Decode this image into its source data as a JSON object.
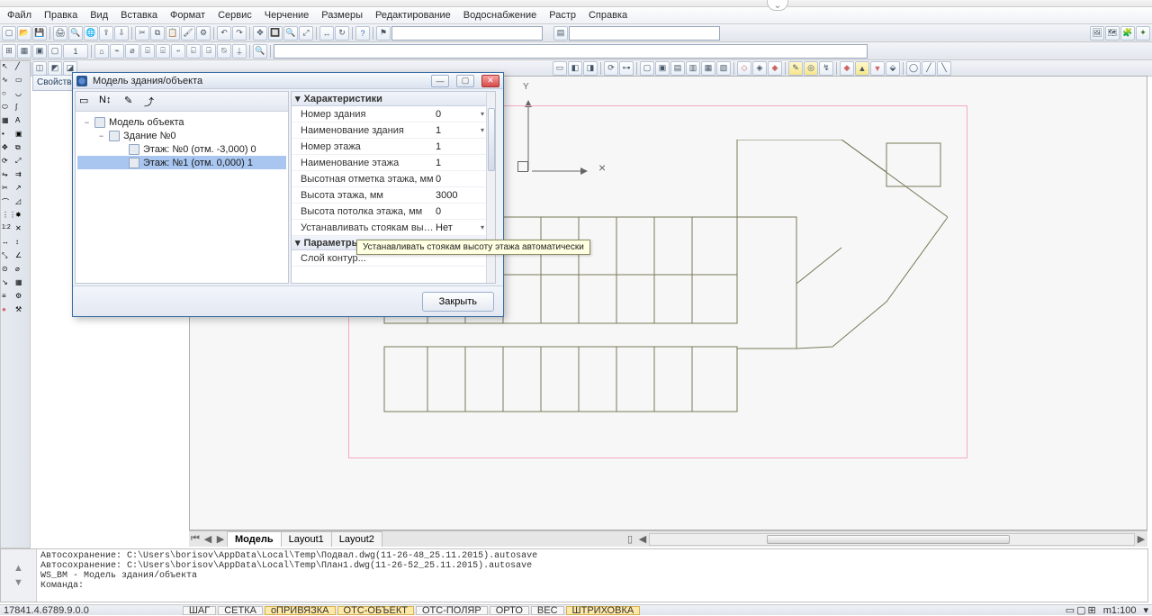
{
  "menubar": [
    "Файл",
    "Правка",
    "Вид",
    "Вставка",
    "Формат",
    "Сервис",
    "Черчение",
    "Размеры",
    "Редактирование",
    "Водоснабжение",
    "Растр",
    "Справка"
  ],
  "dialog": {
    "title": "Модель здания/объекта",
    "close_label": "Закрыть",
    "tree": {
      "root": "Модель объекта",
      "building": "Здание №0",
      "floor0": "Этаж: №0 (отм. -3,000) 0",
      "floor1": "Этаж: №1 (отм. 0,000) 1"
    },
    "sections": {
      "chars": "Характеристики",
      "params": "Параметры"
    },
    "rows": {
      "building_no_l": "Номер здания",
      "building_no_v": "0",
      "building_name_l": "Наименование здания",
      "building_name_v": "1",
      "floor_no_l": "Номер этажа",
      "floor_no_v": "1",
      "floor_name_l": "Наименование этажа",
      "floor_name_v": "1",
      "floor_elev_l": "Высотная отметка этажа, мм",
      "floor_elev_v": "0",
      "floor_h_l": "Высота этажа, мм",
      "floor_h_v": "3000",
      "ceil_h_l": "Высота потолка этажа, мм",
      "ceil_h_v": "0",
      "auto_l": "Устанавливать стоякам высоту эта...",
      "auto_v": "Нет",
      "contour_l": "Слой контур..."
    }
  },
  "tooltip": "Устанавливать стоякам высоту этажа автоматически",
  "tabs": {
    "t1": "Модель",
    "t2": "Layout1",
    "t3": "Layout2"
  },
  "log": "Автосохранение: C:\\Users\\borisov\\AppData\\Local\\Temp\\Подвал.dwg(11-26-48_25.11.2015).autosave\nАвтосохранение: C:\\Users\\borisov\\AppData\\Local\\Temp\\План1.dwg(11-26-52_25.11.2015).autosave\nWS_BM - Модель здания/объекта\nКоманда:",
  "status": {
    "version": "17841.4.6789.9.0.0",
    "shag": "ШАГ",
    "setka": "СЕТКА",
    "opriv": "оПРИВЯЗКА",
    "otsobj": "ОТС-ОБЪЕКТ",
    "otspol": "ОТС-ПОЛЯР",
    "orto": "ОРТО",
    "ves": "ВЕС",
    "shtrih": "ШТРИХОВКА",
    "scale": "m1:100"
  },
  "axis_y": "Y",
  "props_label": "Свойства",
  "row1_num": "1"
}
